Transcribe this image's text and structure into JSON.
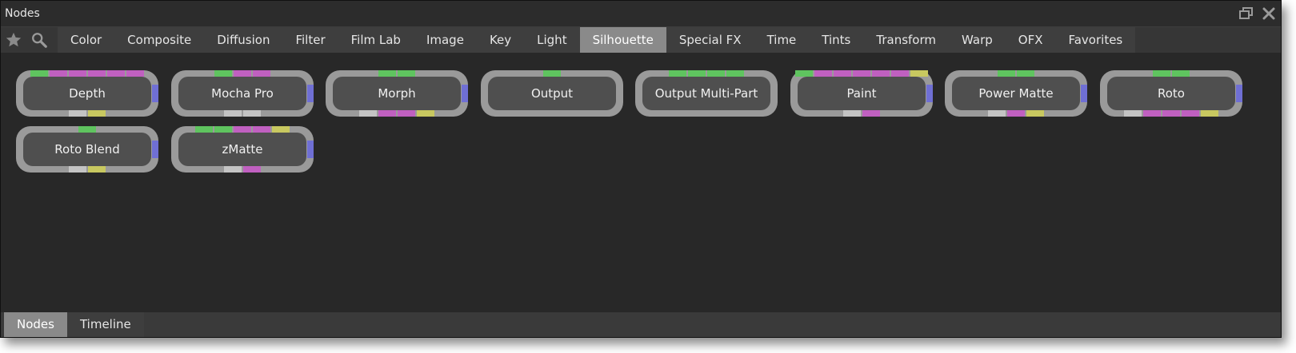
{
  "window": {
    "title": "Nodes"
  },
  "toolbar": {
    "favorites_icon": "star-icon",
    "search_icon": "search-icon"
  },
  "tabs": [
    {
      "label": "Color"
    },
    {
      "label": "Composite"
    },
    {
      "label": "Diffusion"
    },
    {
      "label": "Filter"
    },
    {
      "label": "Film Lab"
    },
    {
      "label": "Image"
    },
    {
      "label": "Key"
    },
    {
      "label": "Light"
    },
    {
      "label": "Silhouette",
      "active": true
    },
    {
      "label": "Special FX"
    },
    {
      "label": "Time"
    },
    {
      "label": "Tints"
    },
    {
      "label": "Transform"
    },
    {
      "label": "Warp"
    },
    {
      "label": "OFX"
    },
    {
      "label": "Favorites"
    }
  ],
  "colors": {
    "green": "#5fc45f",
    "magenta": "#c060c0",
    "gray": "#c4c4c4",
    "yellow": "#c8c860",
    "blue": "#6f6fd4"
  },
  "nodes": [
    {
      "label": "Depth",
      "top": [
        "green",
        "magenta",
        "magenta",
        "magenta",
        "magenta",
        "magenta"
      ],
      "bottom": [
        "gray",
        "yellow"
      ],
      "side": true
    },
    {
      "label": "Mocha Pro",
      "top": [
        "green",
        "magenta",
        "magenta"
      ],
      "bottom": [
        "gray",
        "gray"
      ],
      "side": true
    },
    {
      "label": "Morph",
      "top": [
        "green",
        "green"
      ],
      "bottom": [
        "gray",
        "magenta",
        "magenta",
        "yellow"
      ],
      "side": true
    },
    {
      "label": "Output",
      "top": [
        "green"
      ],
      "bottom": [],
      "side": false
    },
    {
      "label": "Output Multi-Part",
      "top": [
        "green",
        "green",
        "green",
        "green"
      ],
      "bottom": [],
      "side": false
    },
    {
      "label": "Paint",
      "top": [
        "green",
        "magenta",
        "magenta",
        "magenta",
        "magenta",
        "magenta",
        "yellow"
      ],
      "bottom": [
        "gray",
        "magenta"
      ],
      "side": true
    },
    {
      "label": "Power Matte",
      "top": [
        "green",
        "green"
      ],
      "bottom": [
        "gray",
        "magenta",
        "yellow"
      ],
      "side": true
    },
    {
      "label": "Roto",
      "top": [
        "green",
        "green"
      ],
      "bottom": [
        "gray",
        "magenta",
        "magenta",
        "magenta",
        "yellow"
      ],
      "side": true
    },
    {
      "label": "Roto Blend",
      "top": [
        "green"
      ],
      "bottom": [
        "gray",
        "yellow"
      ],
      "side": true
    },
    {
      "label": "zMatte",
      "top": [
        "green",
        "green",
        "magenta",
        "magenta",
        "yellow"
      ],
      "bottom": [
        "gray",
        "magenta"
      ],
      "side": true
    }
  ],
  "bottom_tabs": [
    {
      "label": "Nodes",
      "active": true
    },
    {
      "label": "Timeline"
    }
  ]
}
